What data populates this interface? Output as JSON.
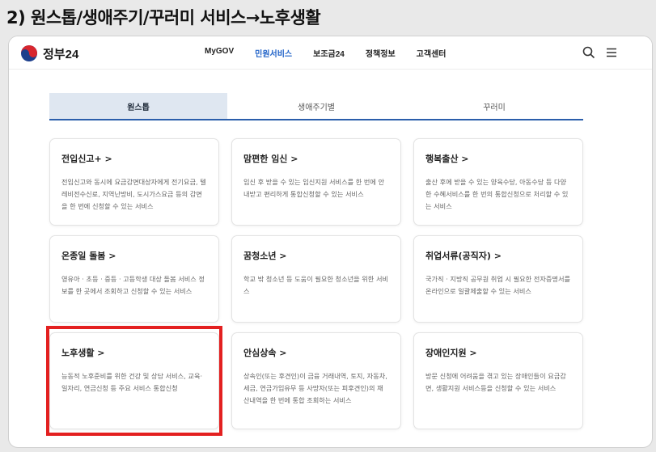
{
  "caption": "2) 원스톱/생애주기/꾸러미 서비스→노후생활",
  "header": {
    "logo_text": "정부24",
    "nav": [
      {
        "label": "MyGOV",
        "active": false
      },
      {
        "label": "민원서비스",
        "active": true
      },
      {
        "label": "보조금24",
        "active": false
      },
      {
        "label": "정책정보",
        "active": false
      },
      {
        "label": "고객센터",
        "active": false
      }
    ]
  },
  "tabs": [
    {
      "label": "원스톱",
      "active": true
    },
    {
      "label": "생애주기별",
      "active": false
    },
    {
      "label": "꾸러미",
      "active": false
    }
  ],
  "cards": [
    {
      "title": "전입신고+ >",
      "desc": "전입신고와 동시에 요금감면대상자에게 전기요금, 텔레비전수신료, 지역난방비, 도시가스요금 등의 감면을 한 번에 신청할 수 있는 서비스"
    },
    {
      "title": "맘편한 임신 >",
      "desc": "임신 후 받을 수 있는 임신지원 서비스를 한 번에 안내받고 편리하게 통합신청할 수 있는 서비스"
    },
    {
      "title": "행복출산 >",
      "desc": "출산 후에 받을 수 있는 양육수당, 아동수당 등 다양한 수혜서비스를 한 번의 통합신청으로 처리할 수 있는 서비스"
    },
    {
      "title": "온종일 돌봄 >",
      "desc": "영유아 · 초등 · 중등 · 고등학생 대상 돌봄 서비스 정보를 한 곳에서 조회하고 신청할 수 있는 서비스"
    },
    {
      "title": "꿈청소년 >",
      "desc": "학교 밖 청소년 등 도움이 필요한 청소년을 위한 서비스"
    },
    {
      "title": "취업서류(공직자) >",
      "desc": "국가직 · 지방직 공무원 취업 시 필요한 전자증명서를 온라인으로 일괄제출할 수 있는 서비스"
    },
    {
      "title": "노후생활 >",
      "desc": "능동적 노후준비를 위한 건강 및 상담 서비스, 교육·일자리, 연금신청 등 주요 서비스 통합신청"
    },
    {
      "title": "안심상속 >",
      "desc": "상속인(또는 후견인)이 금융 거래내역, 토지, 자동차, 세금, 연금가입유무 등 사망자(또는 피후견인)의 재산내역을 한 번에 통합 조회하는 서비스"
    },
    {
      "title": "장애인지원 >",
      "desc": "방문 신청에 어려움을 겪고 있는 장애인들이 요금감면, 생활지원 서비스등을 신청할 수 있는 서비스"
    }
  ],
  "colors": {
    "accent": "#2163c8",
    "highlight": "#e32020",
    "tab_active_bg": "#dfe7f1"
  }
}
